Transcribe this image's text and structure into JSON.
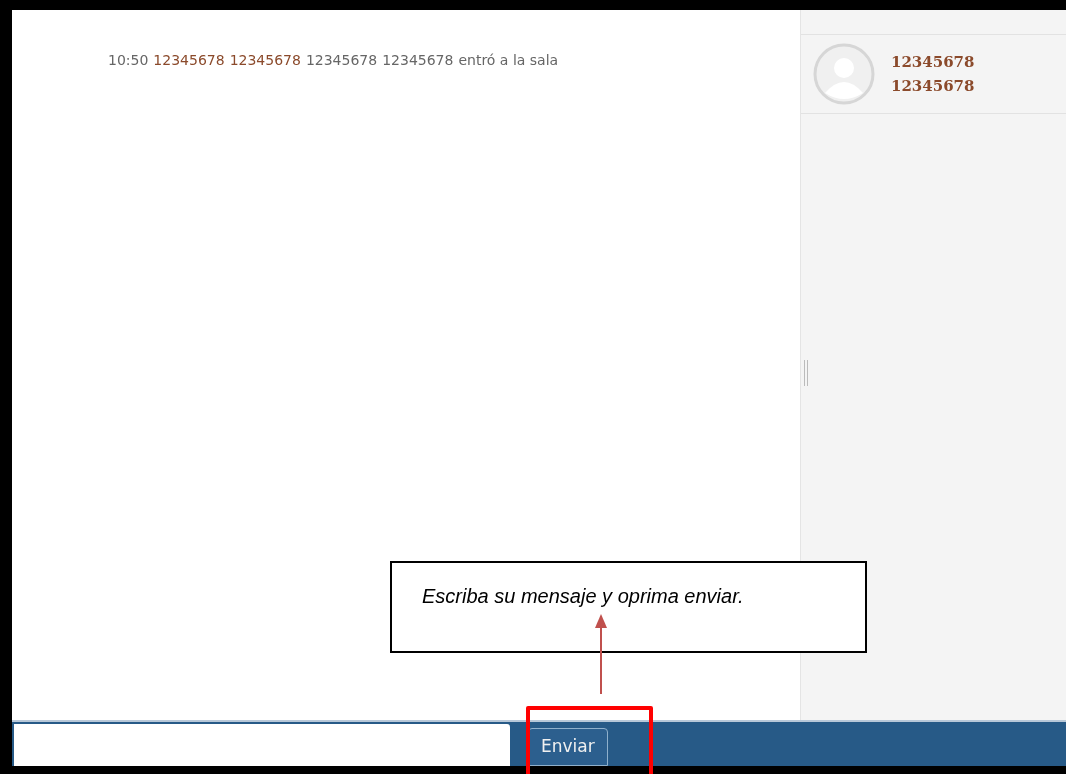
{
  "messages": [
    {
      "time": "10:50",
      "parts": [
        {
          "kind": "name",
          "text": "12345678"
        },
        {
          "kind": "name",
          "text": "12345678"
        },
        {
          "kind": "plain",
          "text": "12345678"
        },
        {
          "kind": "plain",
          "text": "12345678"
        },
        {
          "kind": "plain",
          "text": "entró a la sala"
        }
      ]
    }
  ],
  "users": [
    {
      "first_name": "12345678",
      "last_name": "12345678"
    }
  ],
  "composer": {
    "button": "Enviar"
  },
  "callout": {
    "text": "Escriba su mensaje y oprima enviar."
  }
}
